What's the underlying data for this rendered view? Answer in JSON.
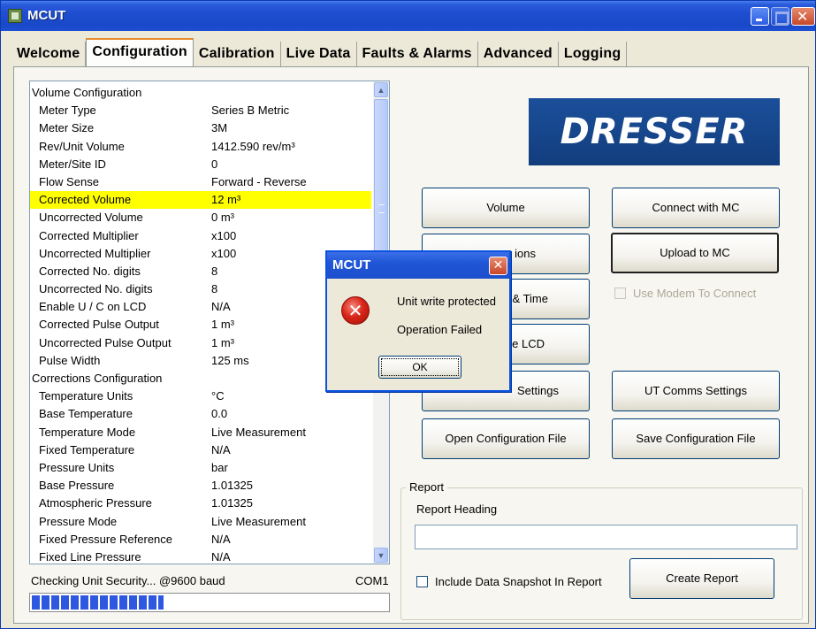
{
  "window": {
    "title": "MCUT"
  },
  "tabs": [
    "Welcome",
    "Configuration",
    "Calibration",
    "Live Data",
    "Faults & Alarms",
    "Advanced",
    "Logging"
  ],
  "active_tab": "Configuration",
  "config_list": [
    {
      "name": "Volume Configuration",
      "value": "",
      "section": true
    },
    {
      "name": "Meter Type",
      "value": "Series B Metric"
    },
    {
      "name": "Meter Size",
      "value": "3M"
    },
    {
      "name": "Rev/Unit Volume",
      "value": "1412.590 rev/m³"
    },
    {
      "name": "Meter/Site ID",
      "value": "0"
    },
    {
      "name": "Flow Sense",
      "value": "Forward - Reverse"
    },
    {
      "name": "Corrected Volume",
      "value": "12 m³",
      "highlight": true
    },
    {
      "name": "Uncorrected Volume",
      "value": "0 m³"
    },
    {
      "name": "Corrected Multiplier",
      "value": "x100"
    },
    {
      "name": "Uncorrected Multiplier",
      "value": "x100"
    },
    {
      "name": "Corrected No. digits",
      "value": "8"
    },
    {
      "name": "Uncorrected No. digits",
      "value": "8"
    },
    {
      "name": "Enable U / C on LCD",
      "value": "N/A"
    },
    {
      "name": "Corrected Pulse Output",
      "value": "1 m³"
    },
    {
      "name": "Uncorrected Pulse Output",
      "value": "1 m³"
    },
    {
      "name": "Pulse Width",
      "value": "125 ms"
    },
    {
      "name": "Corrections Configuration",
      "value": "",
      "section": true
    },
    {
      "name": "Temperature Units",
      "value": "°C"
    },
    {
      "name": "Base Temperature",
      "value": "0.0"
    },
    {
      "name": "Temperature Mode",
      "value": "Live Measurement"
    },
    {
      "name": "Fixed Temperature",
      "value": "N/A"
    },
    {
      "name": "Pressure Units",
      "value": "bar"
    },
    {
      "name": "Base Pressure",
      "value": "1.01325"
    },
    {
      "name": "Atmospheric Pressure",
      "value": "1.01325"
    },
    {
      "name": "Pressure Mode",
      "value": "Live Measurement"
    },
    {
      "name": "Fixed Pressure Reference",
      "value": "N/A"
    },
    {
      "name": "Fixed Line Pressure",
      "value": "N/A"
    }
  ],
  "status": {
    "text": "Checking Unit Security... @9600 baud",
    "port": "COM1",
    "progress": 0.37
  },
  "logo": {
    "text": "DRESSER"
  },
  "buttons": {
    "volume": "Volume",
    "corrections": "ions",
    "date_time": "& Time",
    "lcd": "e LCD",
    "mc_comms": "Settings",
    "open_config": "Open Configuration File",
    "connect": "Connect with MC",
    "upload": "Upload to MC",
    "ut_comms": "UT Comms Settings",
    "save_config": "Save Configuration File",
    "create_report": "Create Report"
  },
  "modem_checkbox": {
    "label": "Use Modem To Connect",
    "checked": false,
    "enabled": false
  },
  "report": {
    "group_label": "Report",
    "heading_label": "Report Heading",
    "heading_value": "",
    "snapshot_label": "Include Data Snapshot In Report",
    "snapshot_checked": false
  },
  "dialog": {
    "title": "MCUT",
    "message1": "Unit write protected",
    "message2": "Operation Failed",
    "ok": "OK",
    "icon": "error-icon"
  },
  "colors": {
    "highlight": "#ffff00",
    "title_bar": "#1f4ed0",
    "logo_bg": "#1b4f9a",
    "progress": "#2f58e0"
  }
}
